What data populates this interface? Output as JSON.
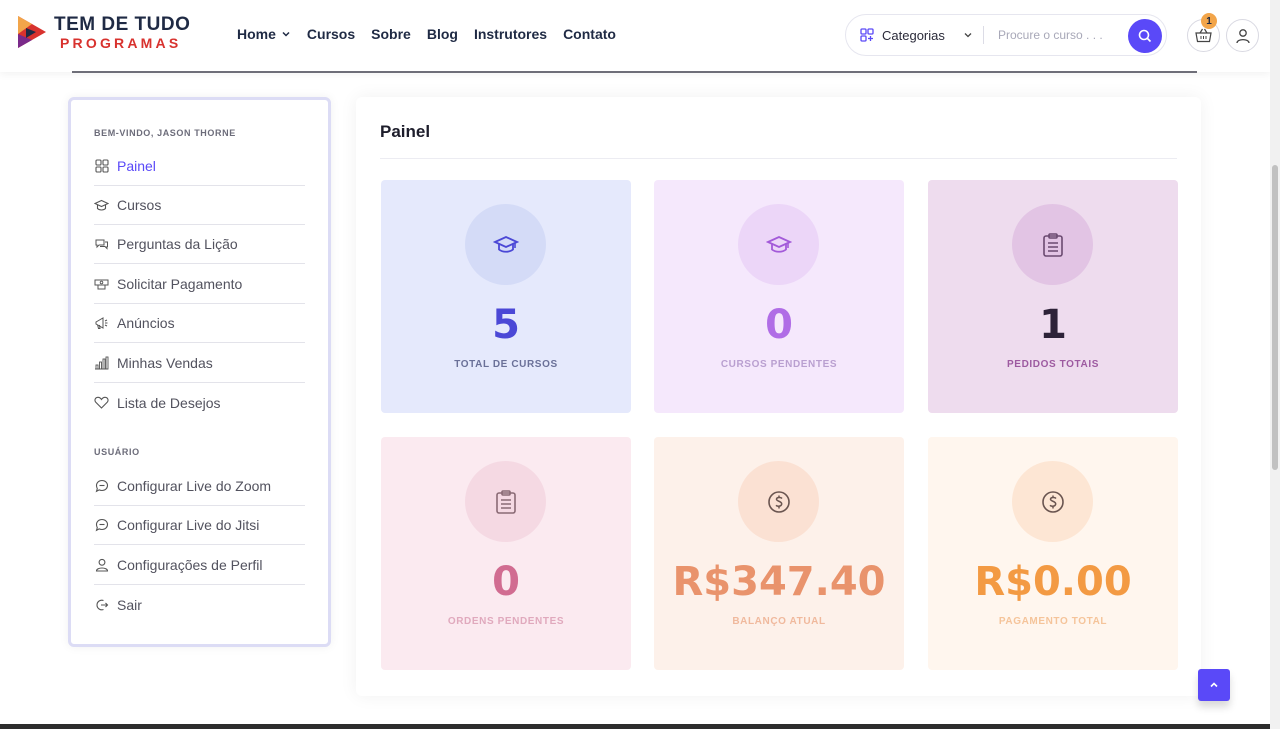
{
  "brand": {
    "line1": "TEM DE TUDO",
    "line2": "PROGRAMAS"
  },
  "nav": [
    {
      "label": "Home",
      "has_dropdown": true
    },
    {
      "label": "Cursos"
    },
    {
      "label": "Sobre"
    },
    {
      "label": "Blog"
    },
    {
      "label": "Instrutores"
    },
    {
      "label": "Contato"
    }
  ],
  "search": {
    "category_label": "Categorias",
    "placeholder": "Procure o curso . . ."
  },
  "cart": {
    "count": "1"
  },
  "sidebar": {
    "welcome_heading": "BEM-VINDO, JASON THORNE",
    "items": [
      {
        "label": "Painel",
        "icon": "grid-icon"
      },
      {
        "label": "Cursos",
        "icon": "graduation-cap-icon"
      },
      {
        "label": "Perguntas da Lição",
        "icon": "chat-icon"
      },
      {
        "label": "Solicitar Pagamento",
        "icon": "money-icon"
      },
      {
        "label": "Anúncios",
        "icon": "megaphone-icon"
      },
      {
        "label": "Minhas Vendas",
        "icon": "bar-chart-icon"
      },
      {
        "label": "Lista de Desejos",
        "icon": "heart-icon"
      }
    ],
    "user_heading": "USUÁRIO",
    "user_items": [
      {
        "label": "Configurar Live do Zoom",
        "icon": "comment-icon"
      },
      {
        "label": "Configurar Live do Jitsi",
        "icon": "comment-icon"
      },
      {
        "label": "Configurações de Perfil",
        "icon": "user-icon"
      },
      {
        "label": "Sair",
        "icon": "logout-icon"
      }
    ]
  },
  "panel": {
    "title": "Painel",
    "cards": [
      {
        "value": "5",
        "label": "TOTAL DE CURSOS",
        "icon": "graduation-cap-icon",
        "bg": "#e5e9fc",
        "circle": "#d4dbf7",
        "value_color": "#4b48d6",
        "label_color": "#6a7098",
        "icon_color": "#4b48d6"
      },
      {
        "value": "0",
        "label": "CURSOS PENDENTES",
        "icon": "graduation-cap-icon",
        "bg": "#f5e8fc",
        "circle": "#ecd6f8",
        "value_color": "#b06de6",
        "label_color": "#b99fd0",
        "icon_color": "#a35ad9"
      },
      {
        "value": "1",
        "label": "PEDIDOS TOTAIS",
        "icon": "clipboard-icon",
        "bg": "#eedcee",
        "circle": "#e2c4e4",
        "value_color": "#2d2238",
        "label_color": "#9d5aa0",
        "icon_color": "#6a4a70"
      },
      {
        "value": "0",
        "label": "ORDENS PENDENTES",
        "icon": "clipboard-icon",
        "bg": "#fbeaf0",
        "circle": "#f5d9e3",
        "value_color": "#d16c91",
        "label_color": "#e0a9bd",
        "icon_color": "#8a6a75"
      },
      {
        "value": "R$347.40",
        "label": "BALANÇO ATUAL",
        "icon": "dollar-icon",
        "bg": "#fdf1ea",
        "circle": "#fbe1d3",
        "value_color": "#e9936c",
        "label_color": "#f0b99d",
        "icon_color": "#6a5550"
      },
      {
        "value": "R$0.00",
        "label": "PAGAMENTO TOTAL",
        "icon": "dollar-icon",
        "bg": "#fff6ee",
        "circle": "#fde6d4",
        "value_color": "#f39a43",
        "label_color": "#f5c49a",
        "icon_color": "#6a5550"
      }
    ]
  }
}
